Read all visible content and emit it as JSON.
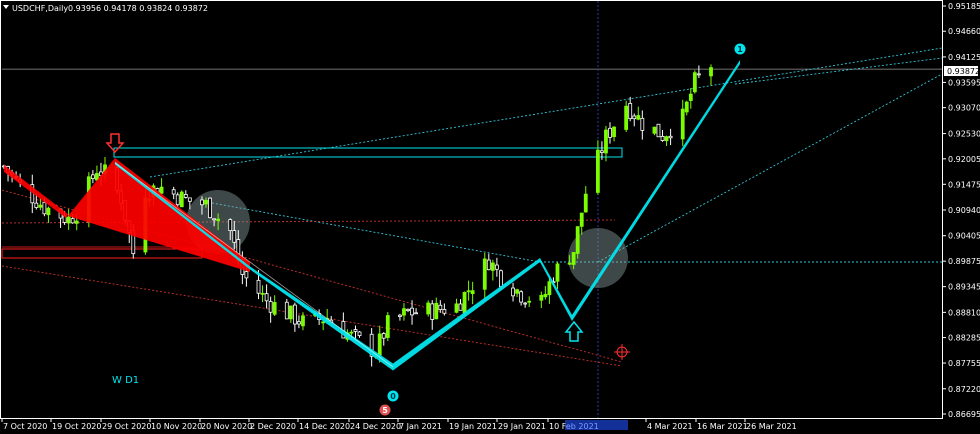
{
  "window": {
    "symbol_label": "USDCHF,Daily",
    "ohlc": "0.93956 0.94178 0.93824 0.93872",
    "menu_icon": "triangle-down-icon"
  },
  "annotations": {
    "wd_label": "W D1",
    "wave_label_0": "0",
    "wave_label_1": "1",
    "wave_label_5": "5",
    "current_price": "0.93872"
  },
  "colors": {
    "background": "#000000",
    "bull": "#7cfc00",
    "bear": "#ffffff",
    "wave": "#00e5ee",
    "red": "#ff0000",
    "dotted_cyan": "#33c6d8",
    "dotted_red": "#c83232",
    "grid": "#ffffff",
    "highlight_circle": "#8aa0a0"
  },
  "chart_data": {
    "type": "candlestick",
    "symbol": "USDCHF",
    "timeframe": "Daily",
    "ylim": [
      0.86695,
      0.95185
    ],
    "y_ticks": [
      0.95185,
      0.9466,
      0.94125,
      0.93595,
      0.9307,
      0.9253,
      0.92005,
      0.91475,
      0.9094,
      0.90405,
      0.89875,
      0.89345,
      0.8881,
      0.88285,
      0.87755,
      0.8722,
      0.86695
    ],
    "x_ticks": [
      "7 Oct 2020",
      "19 Oct 2020",
      "29 Oct 2020",
      "10 Nov 2020",
      "20 Nov 2020",
      "2 Dec 2020",
      "14 Dec 2020",
      "24 Dec 2020",
      "7 Jan 2021",
      "19 Jan 2021",
      "29 Jan 2021",
      "10 Feb 2021",
      "4 Mar 2021",
      "16 Mar 2021",
      "26 Mar 2021"
    ],
    "close_path": [
      {
        "date": "2020-10-05",
        "close": 0.9185
      },
      {
        "date": "2020-10-09",
        "close": 0.9145
      },
      {
        "date": "2020-10-15",
        "close": 0.91
      },
      {
        "date": "2020-10-21",
        "close": 0.9075
      },
      {
        "date": "2020-10-23",
        "close": 0.909
      },
      {
        "date": "2020-10-28",
        "close": 0.918
      },
      {
        "date": "2020-10-30",
        "close": 0.917
      },
      {
        "date": "2020-11-03",
        "close": 0.912
      },
      {
        "date": "2020-11-06",
        "close": 0.9005
      },
      {
        "date": "2020-11-09",
        "close": 0.9135
      },
      {
        "date": "2020-11-13",
        "close": 0.914
      },
      {
        "date": "2020-11-19",
        "close": 0.9115
      },
      {
        "date": "2020-11-24",
        "close": 0.9105
      },
      {
        "date": "2020-11-30",
        "close": 0.905
      },
      {
        "date": "2020-12-03",
        "close": 0.896
      },
      {
        "date": "2020-12-09",
        "close": 0.8905
      },
      {
        "date": "2020-12-14",
        "close": 0.888
      },
      {
        "date": "2020-12-18",
        "close": 0.886
      },
      {
        "date": "2020-12-24",
        "close": 0.887
      },
      {
        "date": "2020-12-30",
        "close": 0.883
      },
      {
        "date": "2021-01-05",
        "close": 0.88
      },
      {
        "date": "2021-01-08",
        "close": 0.8855
      },
      {
        "date": "2021-01-13",
        "close": 0.888
      },
      {
        "date": "2021-01-19",
        "close": 0.8885
      },
      {
        "date": "2021-01-25",
        "close": 0.8895
      },
      {
        "date": "2021-01-29",
        "close": 0.894
      },
      {
        "date": "2021-02-02",
        "close": 0.899
      },
      {
        "date": "2021-02-05",
        "close": 0.8955
      },
      {
        "date": "2021-02-10",
        "close": 0.892
      },
      {
        "date": "2021-02-15",
        "close": 0.89
      },
      {
        "date": "2021-02-18",
        "close": 0.896
      },
      {
        "date": "2021-02-23",
        "close": 0.901
      },
      {
        "date": "2021-02-26",
        "close": 0.913
      },
      {
        "date": "2021-03-03",
        "close": 0.9245
      },
      {
        "date": "2021-03-08",
        "close": 0.9315
      },
      {
        "date": "2021-03-12",
        "close": 0.9275
      },
      {
        "date": "2021-03-17",
        "close": 0.925
      },
      {
        "date": "2021-03-22",
        "close": 0.9285
      },
      {
        "date": "2021-03-25",
        "close": 0.936
      },
      {
        "date": "2021-03-29",
        "close": 0.9395
      }
    ],
    "waves": [
      {
        "label": "0",
        "date": "2021-01-06",
        "price": 0.8772
      },
      {
        "label": "1",
        "date": "2021-03-30",
        "price": 0.94125
      }
    ],
    "current_price": 0.93872,
    "grid": false,
    "legend": "none"
  }
}
